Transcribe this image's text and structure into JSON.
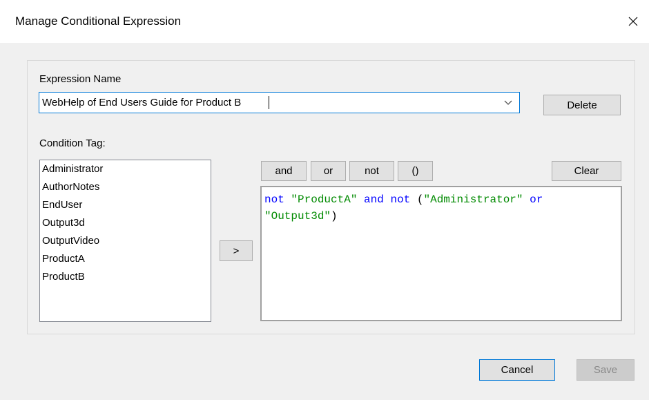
{
  "window": {
    "title": "Manage Conditional Expression",
    "close_glyph": "✕"
  },
  "expression": {
    "label": "Expression Name",
    "value": "WebHelp of End Users Guide for Product B",
    "delete_label": "Delete"
  },
  "condition": {
    "label": "Condition Tag:",
    "tags": [
      "Administrator",
      "AuthorNotes",
      "EndUser",
      "Output3d",
      "OutputVideo",
      "ProductA",
      "ProductB"
    ],
    "add_label": ">"
  },
  "operators": {
    "and": "and",
    "or": "or",
    "not": "not",
    "parens": "()",
    "clear": "Clear"
  },
  "editor": {
    "line1": [
      {
        "t": "not",
        "c": "kw"
      },
      {
        "t": " ",
        "c": "plain"
      },
      {
        "t": "\"ProductA\"",
        "c": "str"
      },
      {
        "t": " ",
        "c": "plain"
      },
      {
        "t": "and",
        "c": "kw"
      },
      {
        "t": " ",
        "c": "plain"
      },
      {
        "t": "not",
        "c": "kw"
      },
      {
        "t": " (",
        "c": "plain"
      },
      {
        "t": "\"Administrator\"",
        "c": "str"
      },
      {
        "t": " ",
        "c": "plain"
      },
      {
        "t": "or",
        "c": "kw"
      }
    ],
    "line2": [
      {
        "t": "\"Output3d\"",
        "c": "str"
      },
      {
        "t": ")",
        "c": "plain"
      }
    ]
  },
  "footer": {
    "cancel_label": "Cancel",
    "save_label": "Save"
  },
  "colors": {
    "keyword": "#0000ff",
    "string": "#008a00",
    "accent": "#0078d7"
  }
}
